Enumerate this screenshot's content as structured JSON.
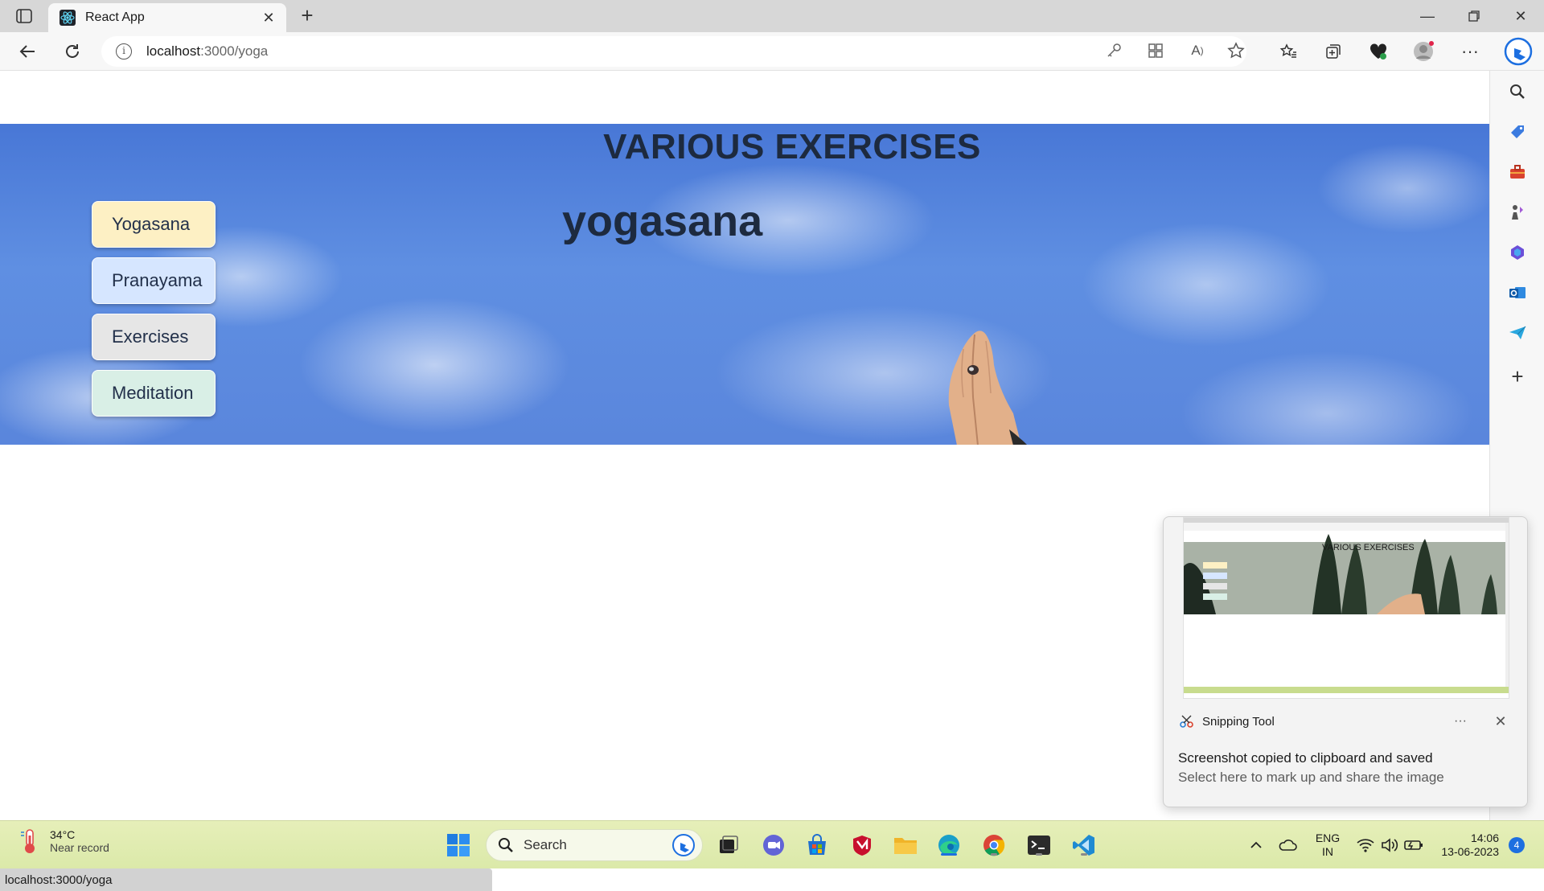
{
  "browser": {
    "tab_title": "React App",
    "url_host": "localhost",
    "url_rest": ":3000/yoga",
    "status_url": "localhost:3000/yoga"
  },
  "page": {
    "title": "VARIOUS EXERCISES",
    "heading": "yogasana",
    "menu": [
      {
        "label": "Yogasana",
        "color": "#fdf0c4"
      },
      {
        "label": "Pranayama",
        "color": "#d6e6ff"
      },
      {
        "label": "Exercises",
        "color": "#e6e6e6"
      },
      {
        "label": "Meditation",
        "color": "#d9efe6"
      }
    ]
  },
  "toast": {
    "app_name": "Snipping Tool",
    "more": "···",
    "close": "✕",
    "message": "Screenshot copied to clipboard and saved",
    "sub_message": "Select here to mark up and share the image",
    "thumb_title": "VARIOUS EXERCISES"
  },
  "taskbar": {
    "temperature": "34°C",
    "weather_desc": "Near record",
    "search_label": "Search",
    "lang_line1": "ENG",
    "lang_line2": "IN",
    "time": "14:06",
    "date": "13-06-2023",
    "notification_count": "4"
  }
}
